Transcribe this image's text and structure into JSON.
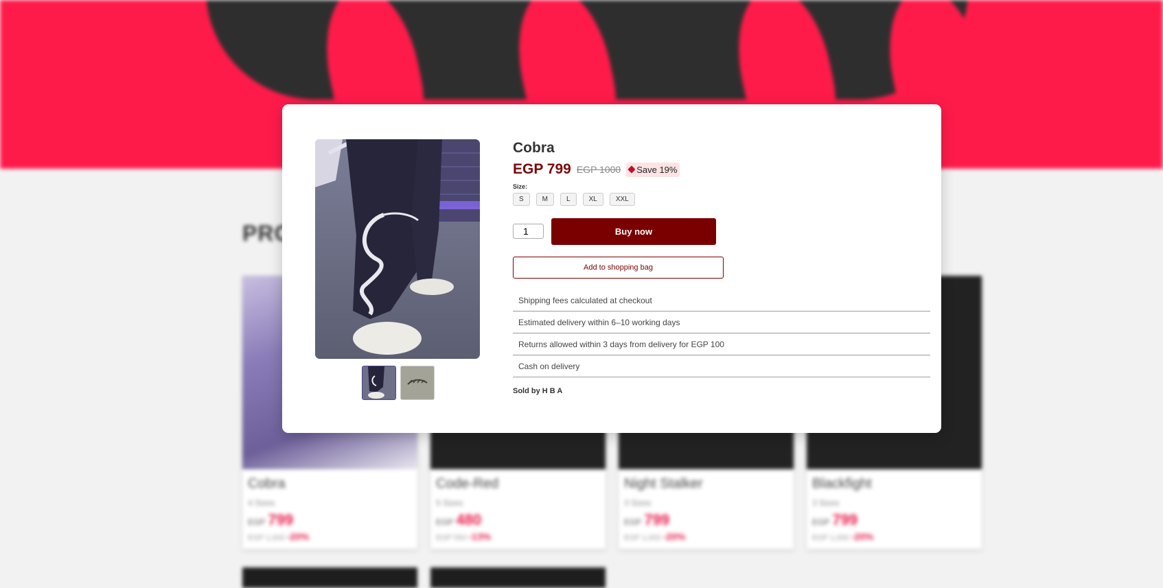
{
  "background": {
    "heading": "PRO",
    "products": [
      {
        "name": "Cobra",
        "sizes": "4 Sizes",
        "currency": "EGP",
        "price": "799",
        "was": "EGP 1,000",
        "discount": "-20%"
      },
      {
        "name": "Code-Red",
        "sizes": "5 Sizes",
        "currency": "EGP",
        "price": "480",
        "was": "EGP 550",
        "discount": "-13%"
      },
      {
        "name": "Night Stalker",
        "sizes": "3 Sizes",
        "currency": "EGP",
        "price": "799",
        "was": "EGP 1,000",
        "discount": "-20%"
      },
      {
        "name": "Blackfight",
        "sizes": "3 Sizes",
        "currency": "EGP",
        "price": "799",
        "was": "EGP 1,000",
        "discount": "-20%"
      }
    ]
  },
  "modal": {
    "title": "Cobra",
    "price": "EGP 799",
    "old_price": "EGP 1000",
    "save_badge": "Save 19%",
    "size_label": "Size:",
    "sizes": [
      "S",
      "M",
      "L",
      "XL",
      "XXL"
    ],
    "quantity": "1",
    "buy_label": "Buy now",
    "add_label": "Add to shopping bag",
    "info": [
      "Shipping fees calculated at checkout",
      "Estimated delivery within 6–10 working days",
      "Returns allowed within 3 days from delivery for EGP 100",
      "Cash on delivery"
    ],
    "sold_by": "Sold by H B A",
    "icons": {
      "tag": "tag-icon"
    }
  },
  "colors": {
    "accent": "#7a0000",
    "price": "#7a0a0a",
    "hero": "#fe1b4a",
    "badge_bg": "#fde3e3"
  }
}
